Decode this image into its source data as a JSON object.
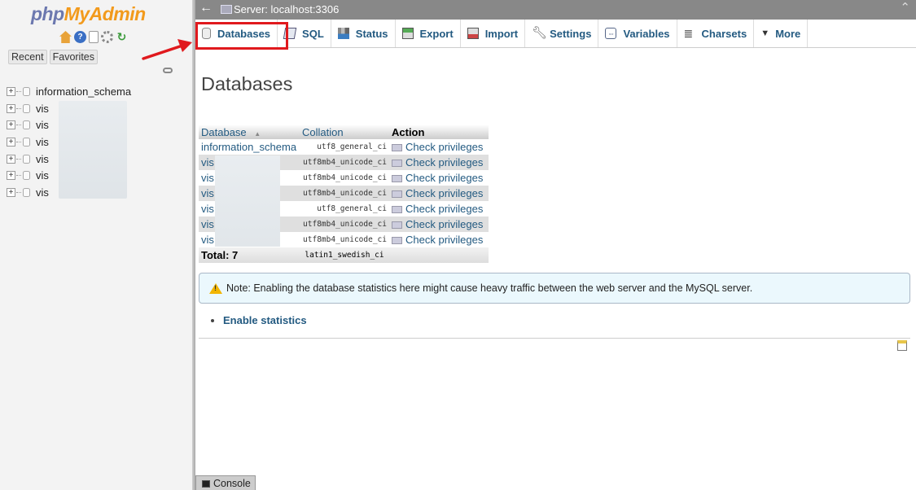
{
  "nav": {
    "logo_php": "php",
    "logo_myadmin": "MyAdmin",
    "icons": [
      "home-icon",
      "help-icon",
      "docs-icon",
      "settings-icon",
      "reload-icon"
    ],
    "tabs": {
      "recent": "Recent",
      "favorites": "Favorites"
    },
    "tree": [
      {
        "label": "information_schema"
      },
      {
        "label": "vis"
      },
      {
        "label": "vis"
      },
      {
        "label": "vis"
      },
      {
        "label": "vis"
      },
      {
        "label": "vis"
      },
      {
        "label": "vis"
      }
    ]
  },
  "serverbar": {
    "label": "Server: localhost:3306"
  },
  "menu": {
    "tabs": [
      {
        "id": "databases",
        "label": "Databases"
      },
      {
        "id": "sql",
        "label": "SQL"
      },
      {
        "id": "status",
        "label": "Status"
      },
      {
        "id": "export",
        "label": "Export"
      },
      {
        "id": "import",
        "label": "Import"
      },
      {
        "id": "settings",
        "label": "Settings"
      },
      {
        "id": "variables",
        "label": "Variables"
      },
      {
        "id": "charsets",
        "label": "Charsets"
      },
      {
        "id": "more",
        "label": "More"
      }
    ]
  },
  "main": {
    "title": "Databases",
    "table": {
      "headers": {
        "database": "Database",
        "sort_indicator": "▲",
        "collation": "Collation",
        "action": "Action"
      },
      "rows": [
        {
          "name": "information_schema",
          "collation": "utf8_general_ci",
          "action": "Check privileges"
        },
        {
          "name": "vis",
          "collation": "utf8mb4_unicode_ci",
          "action": "Check privileges"
        },
        {
          "name": "vis",
          "collation": "utf8mb4_unicode_ci",
          "action": "Check privileges"
        },
        {
          "name": "vis",
          "collation": "utf8mb4_unicode_ci",
          "action": "Check privileges"
        },
        {
          "name": "vis",
          "collation": "utf8_general_ci",
          "action": "Check privileges"
        },
        {
          "name": "vis",
          "collation": "utf8mb4_unicode_ci",
          "action": "Check privileges"
        },
        {
          "name": "vis",
          "collation": "utf8mb4_unicode_ci",
          "action": "Check privileges"
        }
      ],
      "total_label": "Total: 7",
      "total_collation": "latin1_swedish_ci"
    },
    "notice": "Note: Enabling the database statistics here might cause heavy traffic between the web server and the MySQL server.",
    "enable_statistics": "Enable statistics"
  },
  "console": {
    "label": "Console"
  },
  "colors": {
    "accent": "#235a81",
    "highlight": "#e0191d",
    "logo_php": "#6c78af",
    "logo_myadmin": "#f29a1c"
  }
}
